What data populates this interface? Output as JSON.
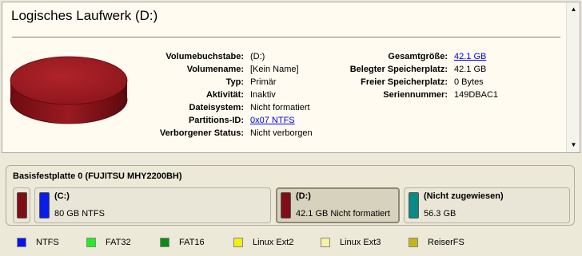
{
  "info": {
    "title": "Logisches Laufwerk (D:)",
    "left_props": [
      {
        "label": "Volumebuchstabe:",
        "value": "(D:)"
      },
      {
        "label": "Volumename:",
        "value": "[Kein Name]"
      },
      {
        "label": "Typ:",
        "value": "Primär"
      },
      {
        "label": "Aktivität:",
        "value": "Inaktiv"
      },
      {
        "label": "Dateisystem:",
        "value": "Nicht formatiert"
      },
      {
        "label": "Partitions-ID:",
        "value": "0x07 NTFS"
      },
      {
        "label": "Verborgener Status:",
        "value": "Nicht verborgen"
      }
    ],
    "right_props": [
      {
        "label": "Gesamtgröße:",
        "value": "42.1 GB"
      },
      {
        "label": "Belegter Speicherplatz:",
        "value": "42.1 GB"
      },
      {
        "label": "Freier Speicherplatz:",
        "value": "0 Bytes"
      },
      {
        "label": "Seriennummer:",
        "value": "149DBAC1"
      }
    ],
    "scroll_up_icon": "triangle-up",
    "scroll_down_icon": "triangle-down"
  },
  "disk": {
    "name": "Basisfestplatte 0 (FUJITSU MHY2200BH)",
    "segments": [
      {
        "title": "",
        "sub": "",
        "color": "#7f0f16"
      },
      {
        "title": "(C:)",
        "sub": "80 GB NTFS",
        "color": "#0a1ee8"
      },
      {
        "title": "(D:)",
        "sub": "42.1 GB Nicht formatiert",
        "color": "#7f0f16"
      },
      {
        "title": "(Nicht zugewiesen)",
        "sub": "56.3 GB",
        "color": "#0a8a84"
      }
    ]
  },
  "legend": [
    {
      "label": "NTFS",
      "color": "#0a14e6"
    },
    {
      "label": "FAT32",
      "color": "#22ee22"
    },
    {
      "label": "FAT16",
      "color": "#0a8a18"
    },
    {
      "label": "Linux Ext2",
      "color": "#f2ef16"
    },
    {
      "label": "Linux Ext3",
      "color": "#f7f2a4"
    },
    {
      "label": "ReiserFS",
      "color": "#c4b616"
    }
  ]
}
